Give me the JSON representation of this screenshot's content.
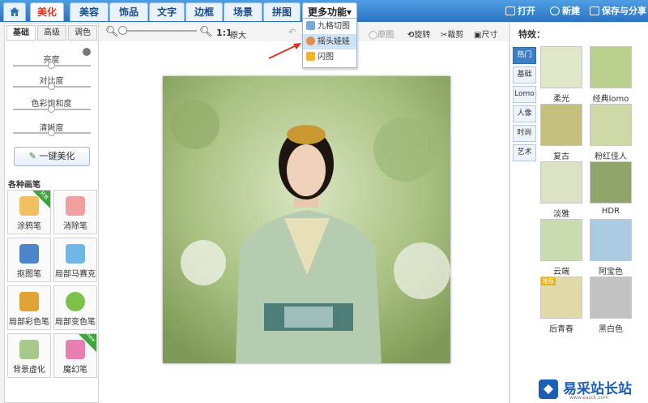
{
  "colors": {
    "topbar": "#3a86d4",
    "accent": "#d0372b",
    "selected_tab": "#3d7fc6"
  },
  "topnav": {
    "tabs": [
      {
        "label": "美化",
        "active": true
      },
      {
        "label": "美容"
      },
      {
        "label": "饰品"
      },
      {
        "label": "文字"
      },
      {
        "label": "边框"
      },
      {
        "label": "场景"
      },
      {
        "label": "拼图"
      }
    ],
    "more_label": "更多功能",
    "open_label": "打开",
    "new_label": "新建",
    "save_label": "保存与分享"
  },
  "toolbar": {
    "zoom_ratio": "1:1",
    "original_size": "原大",
    "original_image": "原图",
    "rotate": "旋转",
    "crop": "裁剪",
    "size": "尺寸"
  },
  "dropdown": {
    "items": [
      "九格切图",
      "摇头娃娃",
      "闪图"
    ]
  },
  "left": {
    "subtabs": [
      "基础",
      "高级",
      "调色"
    ],
    "adjustments": [
      "亮度",
      "对比度",
      "色彩饱和度",
      "清晰度"
    ],
    "one_click": "一键美化",
    "brushes_title": "各种画笔",
    "brushes": [
      "涂鸦笔",
      "消除笔",
      "抠图笔",
      "局部马赛克",
      "局部彩色笔",
      "局部变色笔",
      "背景虚化",
      "魔幻笔"
    ],
    "ribbon_open": "开放",
    "ribbon_new": "new"
  },
  "right": {
    "title": "特效：",
    "categories": [
      "热门",
      "基础",
      "Lomo",
      "人像",
      "时尚",
      "艺术"
    ],
    "effects": [
      "柔光",
      "经典lomo",
      "复古",
      "粉红佳人",
      "淡雅",
      "HDR",
      "云端",
      "阿宝色",
      "后青春",
      "黑白色"
    ],
    "badge": "推荐"
  },
  "watermark": {
    "text": "易采站长站",
    "sub": "www.easck.com"
  }
}
